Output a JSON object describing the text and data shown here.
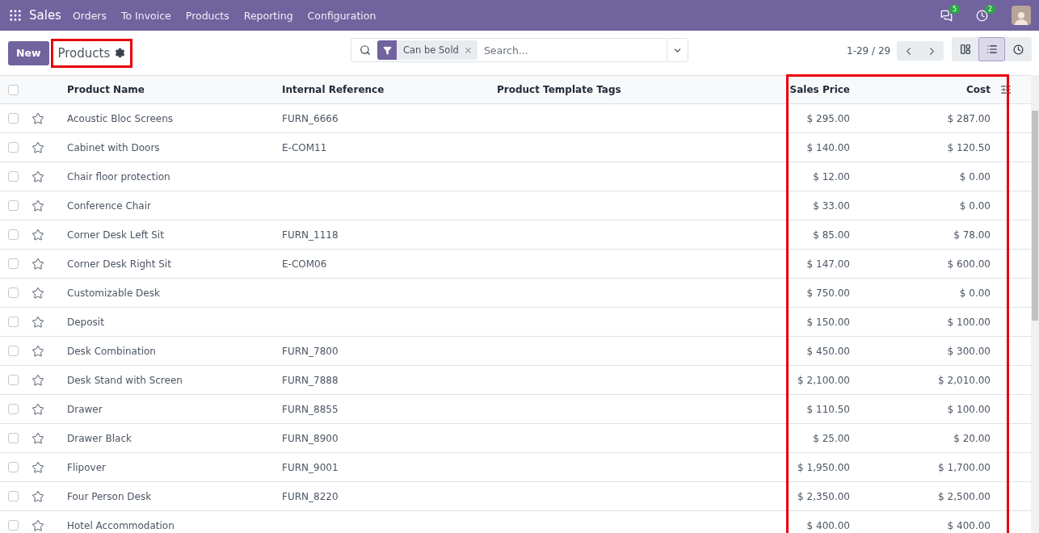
{
  "navbar": {
    "app": "Sales",
    "menu": [
      "Orders",
      "To Invoice",
      "Products",
      "Reporting",
      "Configuration"
    ],
    "messages_count": "5",
    "activities_count": "2"
  },
  "control_panel": {
    "new_button": "New",
    "breadcrumb": {
      "label": "Products",
      "highlighted": true
    },
    "search": {
      "facet": "Can be Sold",
      "placeholder": "Search..."
    },
    "pager": "1-29 / 29",
    "views": [
      {
        "kind": "kanban",
        "selected": false
      },
      {
        "kind": "list",
        "selected": true
      },
      {
        "kind": "activity",
        "selected": false
      }
    ]
  },
  "table": {
    "all_checked": false,
    "columns": [
      {
        "label": "Product Name",
        "kind": "text",
        "highlighted": false
      },
      {
        "label": "Internal Reference",
        "kind": "text",
        "highlighted": false
      },
      {
        "label": "Product Template Tags",
        "kind": "text",
        "highlighted": false
      },
      {
        "label": "Sales Price",
        "kind": "monetary",
        "highlighted": true
      },
      {
        "label": "Cost",
        "kind": "monetary",
        "highlighted": true
      }
    ],
    "rows": [
      {
        "cells": [
          "Acoustic Bloc Screens",
          "FURN_6666",
          "",
          "$ 295.00",
          "$ 287.00"
        ],
        "checked": false,
        "favorite": false
      },
      {
        "cells": [
          "Cabinet with Doors",
          "E-COM11",
          "",
          "$ 140.00",
          "$ 120.50"
        ],
        "checked": false,
        "favorite": false
      },
      {
        "cells": [
          "Chair floor protection",
          "",
          "",
          "$ 12.00",
          "$ 0.00"
        ],
        "checked": false,
        "favorite": false
      },
      {
        "cells": [
          "Conference Chair",
          "",
          "",
          "$ 33.00",
          "$ 0.00"
        ],
        "checked": false,
        "favorite": false
      },
      {
        "cells": [
          "Corner Desk Left Sit",
          "FURN_1118",
          "",
          "$ 85.00",
          "$ 78.00"
        ],
        "checked": false,
        "favorite": false
      },
      {
        "cells": [
          "Corner Desk Right Sit",
          "E-COM06",
          "",
          "$ 147.00",
          "$ 600.00"
        ],
        "checked": false,
        "favorite": false
      },
      {
        "cells": [
          "Customizable Desk",
          "",
          "",
          "$ 750.00",
          "$ 0.00"
        ],
        "checked": false,
        "favorite": false
      },
      {
        "cells": [
          "Deposit",
          "",
          "",
          "$ 150.00",
          "$ 100.00"
        ],
        "checked": false,
        "favorite": false
      },
      {
        "cells": [
          "Desk Combination",
          "FURN_7800",
          "",
          "$ 450.00",
          "$ 300.00"
        ],
        "checked": false,
        "favorite": false
      },
      {
        "cells": [
          "Desk Stand with Screen",
          "FURN_7888",
          "",
          "$ 2,100.00",
          "$ 2,010.00"
        ],
        "checked": false,
        "favorite": false
      },
      {
        "cells": [
          "Drawer",
          "FURN_8855",
          "",
          "$ 110.50",
          "$ 100.00"
        ],
        "checked": false,
        "favorite": false
      },
      {
        "cells": [
          "Drawer Black",
          "FURN_8900",
          "",
          "$ 25.00",
          "$ 20.00"
        ],
        "checked": false,
        "favorite": false
      },
      {
        "cells": [
          "Flipover",
          "FURN_9001",
          "",
          "$ 1,950.00",
          "$ 1,700.00"
        ],
        "checked": false,
        "favorite": false
      },
      {
        "cells": [
          "Four Person Desk",
          "FURN_8220",
          "",
          "$ 2,350.00",
          "$ 2,500.00"
        ],
        "checked": false,
        "favorite": false
      },
      {
        "cells": [
          "Hotel Accommodation",
          "",
          "",
          "$ 400.00",
          "$ 400.00"
        ],
        "checked": false,
        "favorite": false
      }
    ]
  }
}
